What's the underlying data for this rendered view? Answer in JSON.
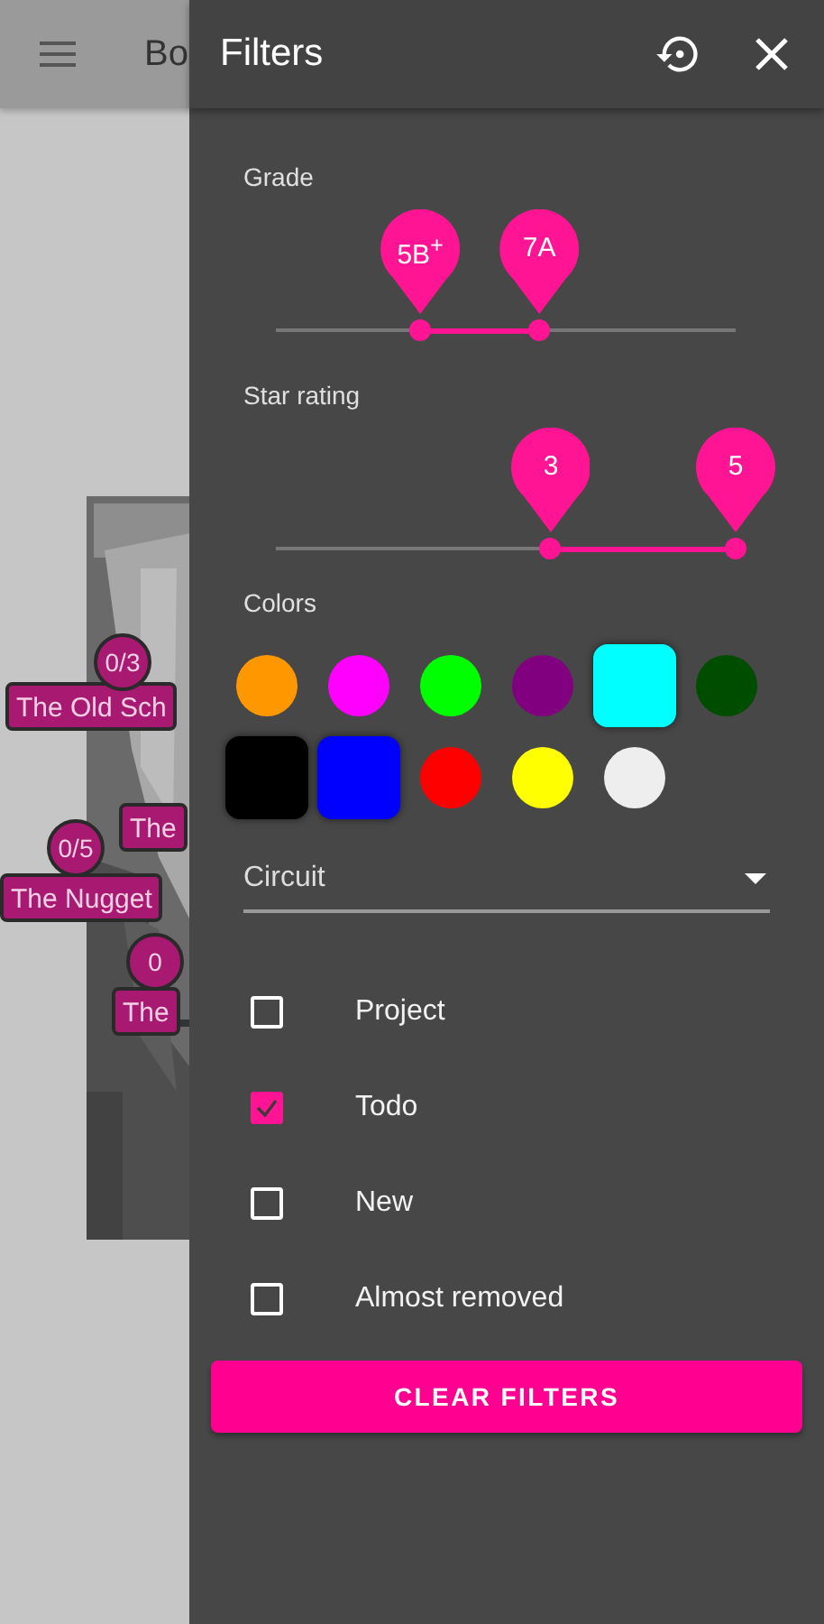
{
  "app_bar": {
    "title": "Bo"
  },
  "wall_markers": [
    {
      "kind": "count",
      "text": "0/3"
    },
    {
      "kind": "name",
      "text": "The Old Sch"
    },
    {
      "kind": "name",
      "text": "The"
    },
    {
      "kind": "count",
      "text": "0/5"
    },
    {
      "kind": "name",
      "text": "The Nugget"
    },
    {
      "kind": "count",
      "text": "0"
    },
    {
      "kind": "name",
      "text": "The"
    }
  ],
  "drawer": {
    "title": "Filters"
  },
  "grade": {
    "label": "Grade",
    "thumbs": [
      {
        "value": "5B$^{+}$",
        "level": 0.314
      },
      {
        "value": "7A",
        "level": 0.573
      }
    ]
  },
  "star_rating": {
    "label": "Star rating",
    "thumbs": [
      {
        "value": "3",
        "level": 0.598
      },
      {
        "value": "5",
        "level": 1
      }
    ]
  },
  "colors": {
    "label": "Colors",
    "swatches": [
      {
        "color": "#ff9800",
        "selected": false
      },
      {
        "color": "#ff00ff",
        "selected": false
      },
      {
        "color": "#00ff00",
        "selected": false
      },
      {
        "color": "#800080",
        "selected": false
      },
      {
        "color": "#00ffff",
        "selected": true
      },
      {
        "color": "#004d00",
        "selected": false
      },
      {
        "color": "#000000",
        "selected": true
      },
      {
        "color": "#0000ff",
        "selected": true
      },
      {
        "color": "#ff0000",
        "selected": false
      },
      {
        "color": "#ffff00",
        "selected": false
      },
      {
        "color": "#eeeeee",
        "selected": false
      }
    ]
  },
  "circuit": {
    "placeholder": "Circuit"
  },
  "checkboxes": [
    {
      "label": "Project",
      "checked": false
    },
    {
      "label": "Todo",
      "checked": true
    },
    {
      "label": "New",
      "checked": false
    },
    {
      "label": "Almost removed",
      "checked": false
    }
  ],
  "clear_button": "CLEAR FILTERS"
}
